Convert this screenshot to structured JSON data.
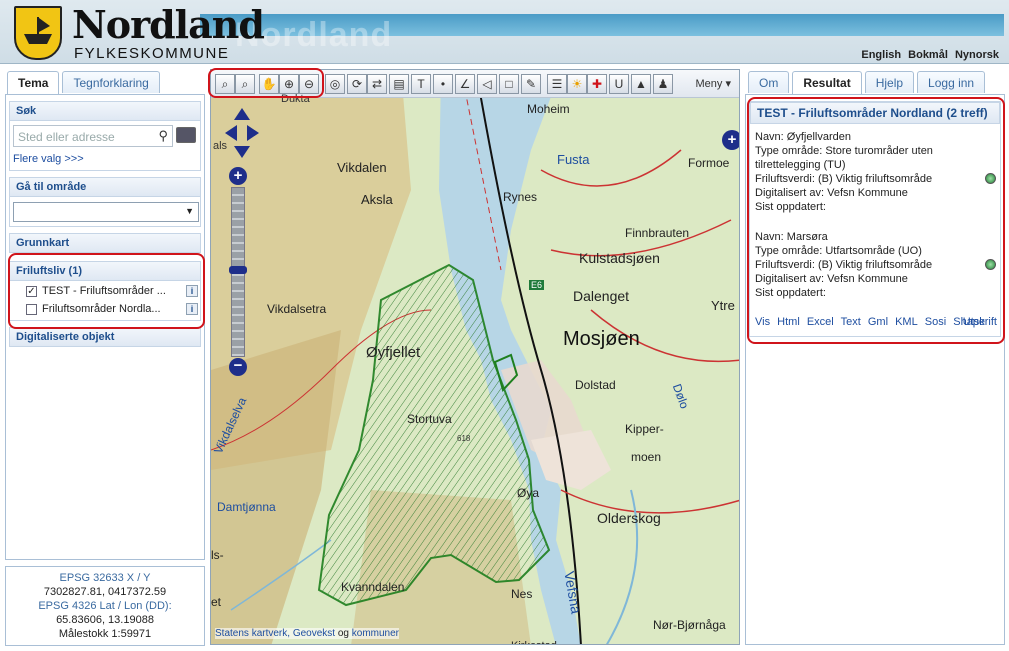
{
  "header": {
    "brand_name": "Nordland",
    "brand_sub": "FYLKESKOMMUNE",
    "ghost": "Nordland",
    "languages": [
      "English",
      "Bokmål",
      "Nynorsk"
    ]
  },
  "left": {
    "tabs": [
      "Tema",
      "Tegnforklaring"
    ],
    "search": {
      "title": "Søk",
      "placeholder": "Sted eller adresse",
      "more": "Flere valg >>>"
    },
    "goto": {
      "title": "Gå til område"
    },
    "basemap": {
      "title": "Grunnkart"
    },
    "layers": {
      "title": "Friluftsliv (1)",
      "items": [
        {
          "label": "TEST - Friluftsområder ...",
          "checked": true
        },
        {
          "label": "Friluftsområder Nordla...",
          "checked": false
        }
      ]
    },
    "digitized": {
      "title": "Digitaliserte objekt"
    }
  },
  "coords": {
    "l1": "EPSG 32633 X / Y",
    "l2": "7302827.81, 0417372.59",
    "l3": "EPSG 4326 Lat / Lon (DD):",
    "l4": "65.83606, 13.19088",
    "l5": "Målestokk 1:59971"
  },
  "map": {
    "menu": "Meny ▾",
    "credits": {
      "a": "Statens kartverk",
      "b": "Geovekst",
      "c": "og",
      "d": "kommuner"
    },
    "labels": {
      "vikdalen": "Vikdalen",
      "aksla": "Aksla",
      "vikdalsetra": "Vikdalsetra",
      "oyfjellet": "Øyfjellet",
      "stortuva": "Stortuva",
      "h618": "618",
      "vikdalselva": "Vikdalselva",
      "damtjonna": "Damtjønna",
      "kvanndalen": "Kvanndalen",
      "nes": "Nes",
      "moheim": "Moheim",
      "fusta": "Fusta",
      "formoen": "Formoe",
      "rynes": "Rynes",
      "finnbrauten": "Finnbrauten",
      "kulstadsjoen": "Kulstadsjøen",
      "dalenget": "Dalenget",
      "ytre": "Ytre",
      "mosjoen": "Mosjøen",
      "dolstad": "Dolstad",
      "kipper": "Kipper-",
      "moen": "moen",
      "oya": "Øya",
      "olderskog": "Olderskog",
      "vefsna": "Vefsna",
      "nerbjornaga": "Nør-Bjørnåga",
      "dolo": "Dølo",
      "e6": "E6",
      "kirkestad": "Kirkestad",
      "dukta": "Dukta",
      "als": "als",
      "ls": "ls-",
      "et": "et"
    }
  },
  "right": {
    "tabs": [
      "Om",
      "Resultat",
      "Hjelp",
      "Logg inn"
    ],
    "title": "TEST - Friluftsområder Nordland (2 treff)",
    "r1": {
      "navn": "Navn: Øyfjellvarden",
      "type": "Type område: Store turområder uten",
      "type2": "tilrettelegging (TU)",
      "verdi": "Friluftsverdi: (B) Viktig friluftsområde",
      "dig": "Digitalisert av: Vefsn Kommune",
      "oppd": "Sist oppdatert:"
    },
    "r2": {
      "navn": "Navn: Marsøra",
      "type": "Type område: Utfartsområde (UO)",
      "verdi": "Friluftsverdi: (B) Viktig friluftsområde",
      "dig": "Digitalisert av: Vefsn Kommune",
      "oppd": "Sist oppdatert:"
    },
    "links": [
      "Vis",
      "Html",
      "Excel",
      "Text",
      "Gml",
      "KML",
      "Sosi",
      "Shape"
    ],
    "print": "Utskrift"
  }
}
